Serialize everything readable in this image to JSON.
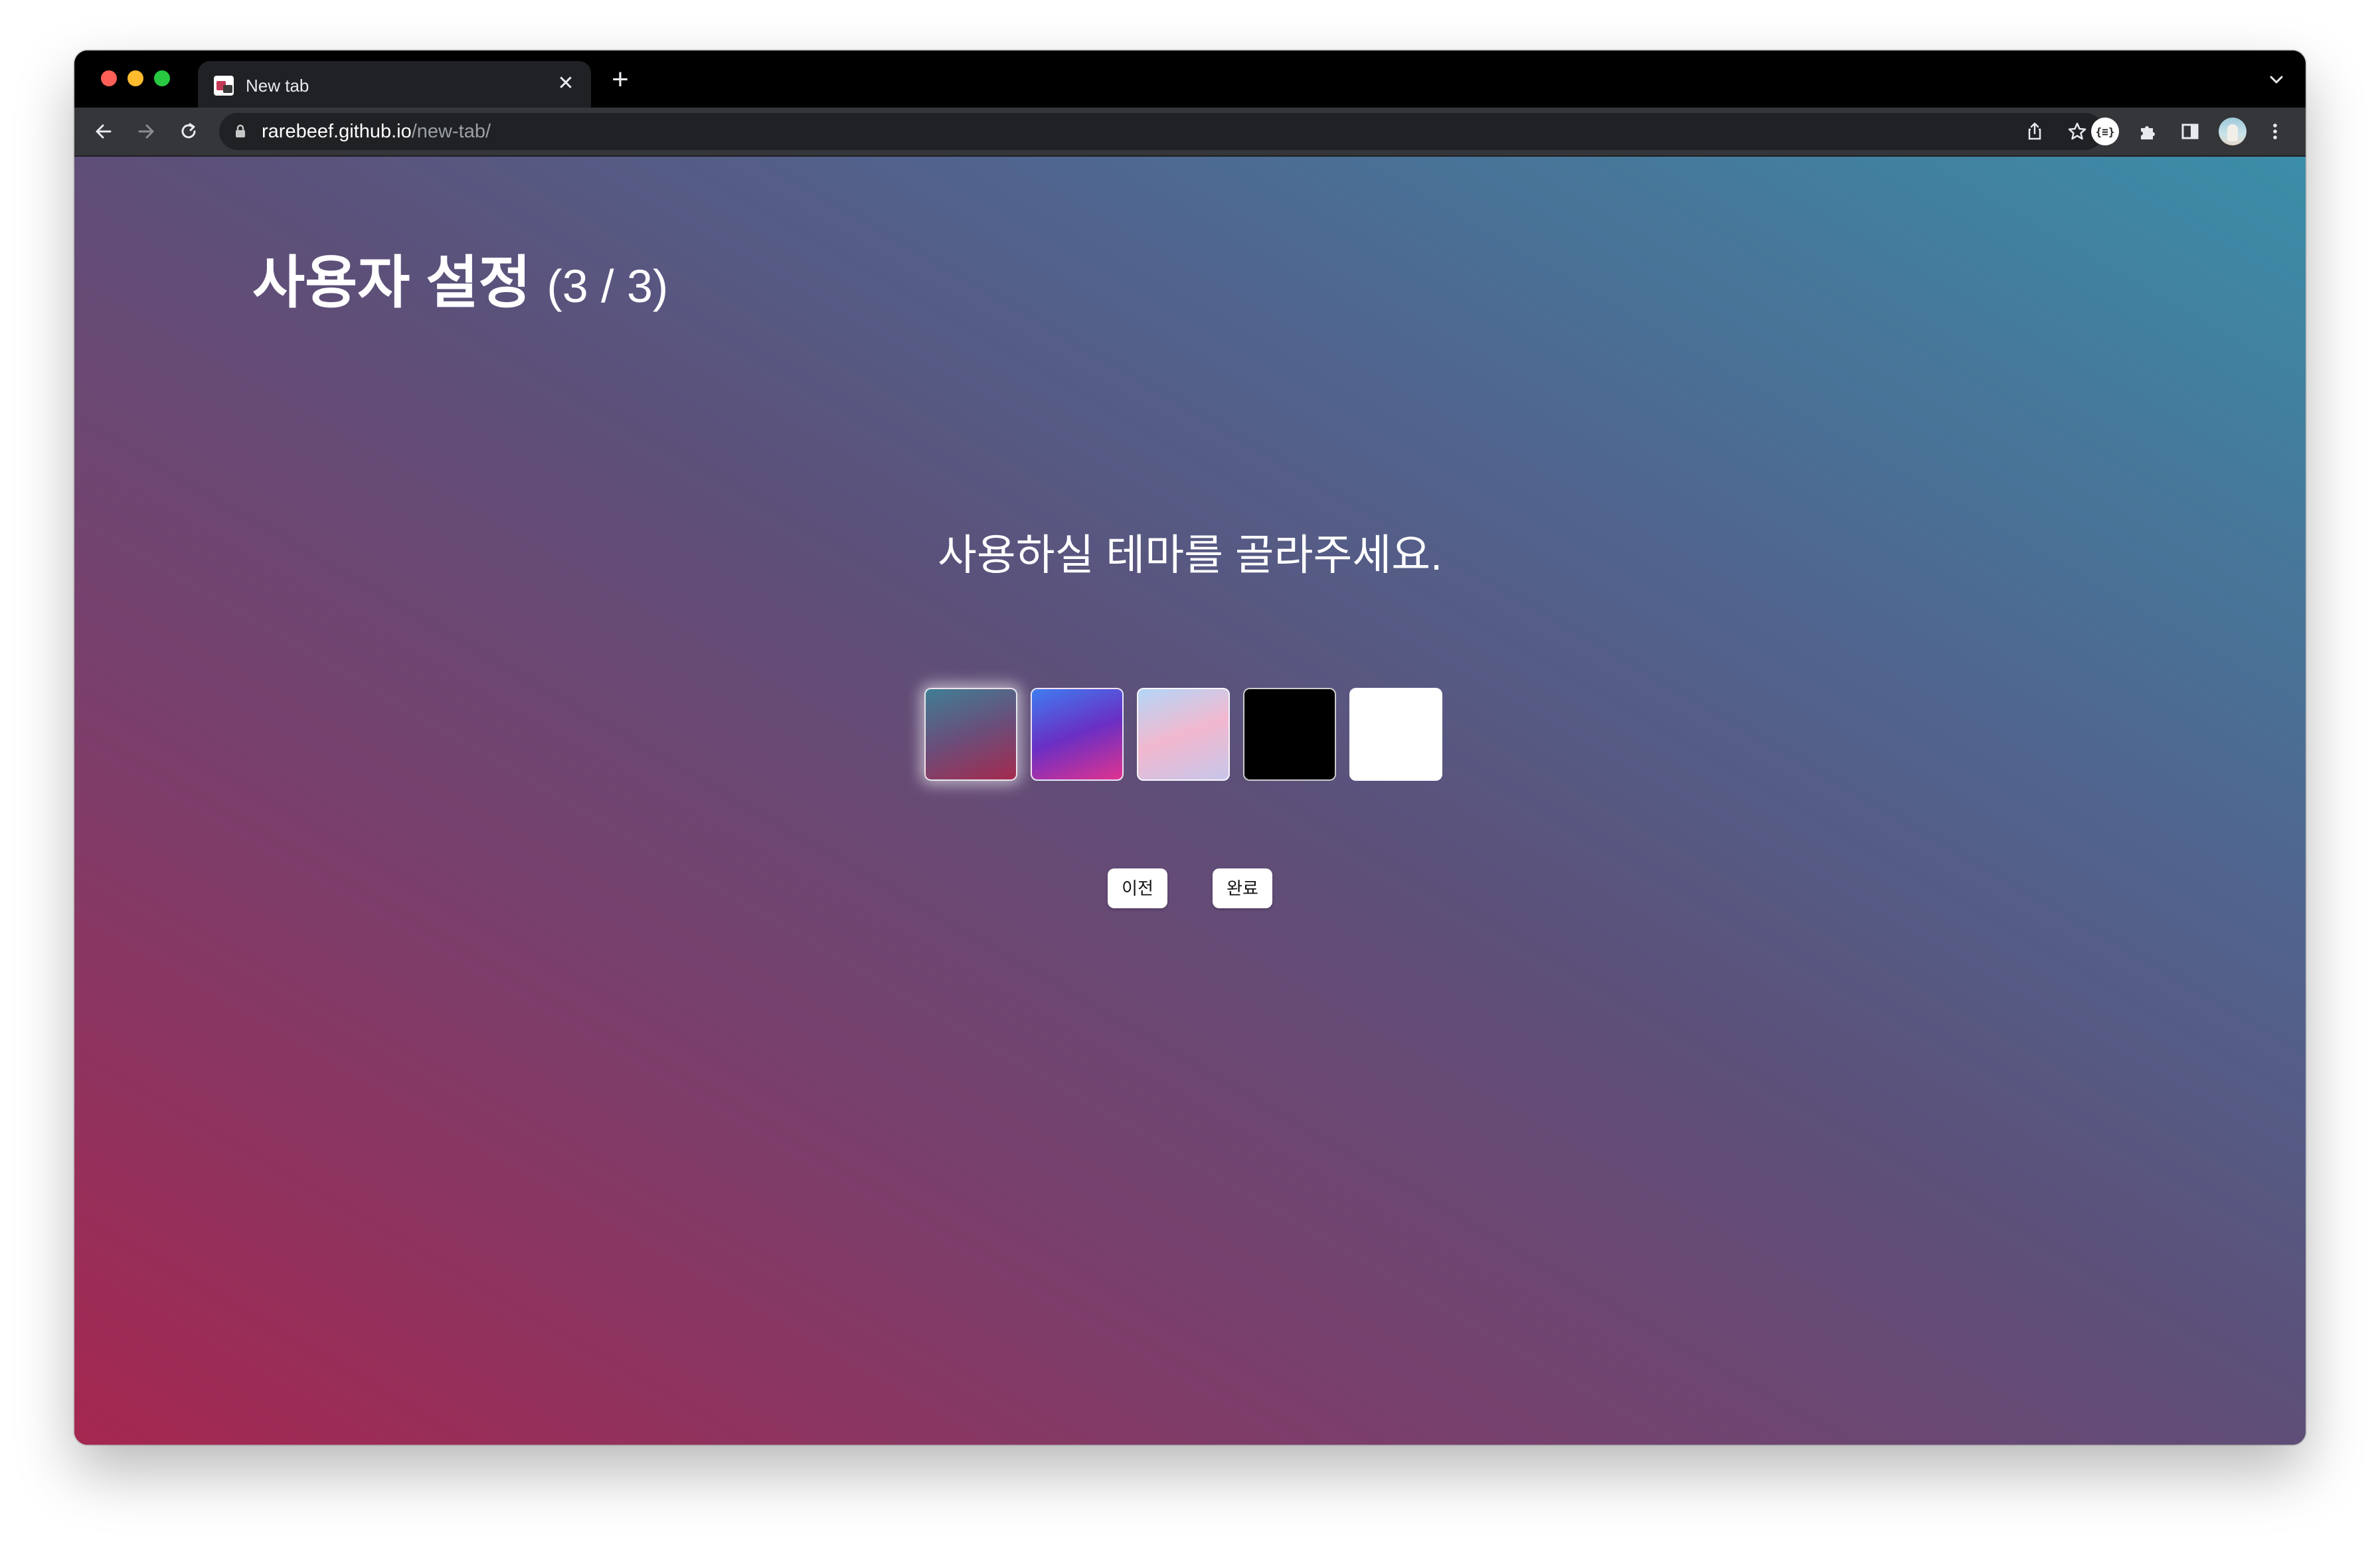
{
  "browser": {
    "tab_title": "New tab",
    "tab_close_glyph": "✕",
    "new_tab_glyph": "+",
    "url_domain": "rarebeef.github.io",
    "url_path": "/new-tab/",
    "extension_badge": "{≡}",
    "icons": [
      "back-arrow-icon",
      "forward-arrow-icon",
      "reload-icon",
      "lock-icon",
      "share-icon",
      "bookmark-star-icon",
      "extension-icon",
      "puzzle-icon",
      "side-panel-icon",
      "profile-avatar-icon",
      "more-menu-icon",
      "tab-list-chevron-icon"
    ]
  },
  "page": {
    "title": "사용자 설정",
    "step": "(3 / 3)",
    "prompt": "사용하실 테마를 골라주세요.",
    "themes": [
      {
        "name": "teal-crimson",
        "selected": true,
        "colors": [
          "#3f7e95",
          "#6a4e7a",
          "#a52a4f"
        ]
      },
      {
        "name": "blue-violet-magenta",
        "selected": false,
        "colors": [
          "#3f7cf0",
          "#6a2fc4",
          "#e0338f"
        ]
      },
      {
        "name": "pastel-pink-blue",
        "selected": false,
        "colors": [
          "#b3d6f7",
          "#f2b8cf",
          "#c7c6ea"
        ]
      },
      {
        "name": "black",
        "selected": false,
        "colors": [
          "#000000"
        ]
      },
      {
        "name": "white",
        "selected": false,
        "colors": [
          "#ffffff"
        ]
      }
    ],
    "prev_label": "이전",
    "done_label": "완료"
  }
}
